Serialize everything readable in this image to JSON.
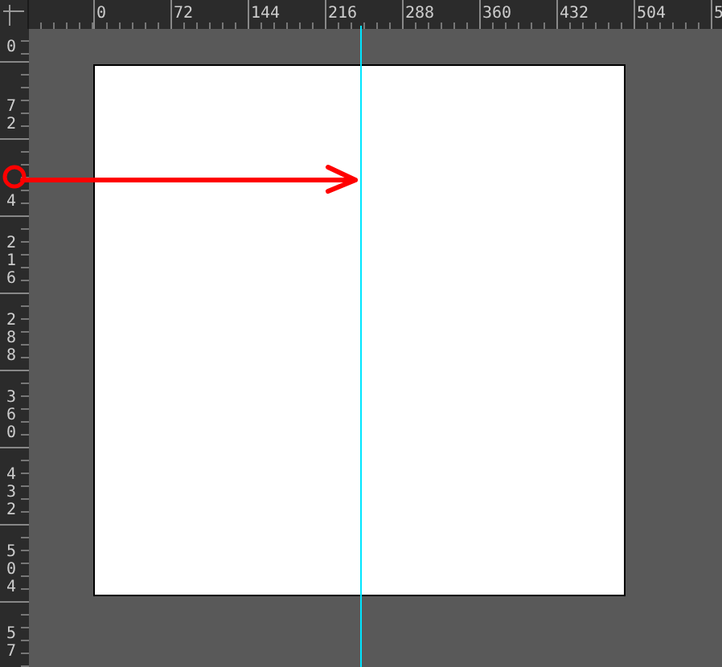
{
  "rulers": {
    "horizontal": [
      "0",
      "72",
      "144",
      "216",
      "288",
      "360",
      "432",
      "504",
      "5"
    ],
    "vertical": [
      "0",
      "72",
      "4",
      "216",
      "288",
      "360",
      "432",
      "504",
      "57"
    ]
  }
}
